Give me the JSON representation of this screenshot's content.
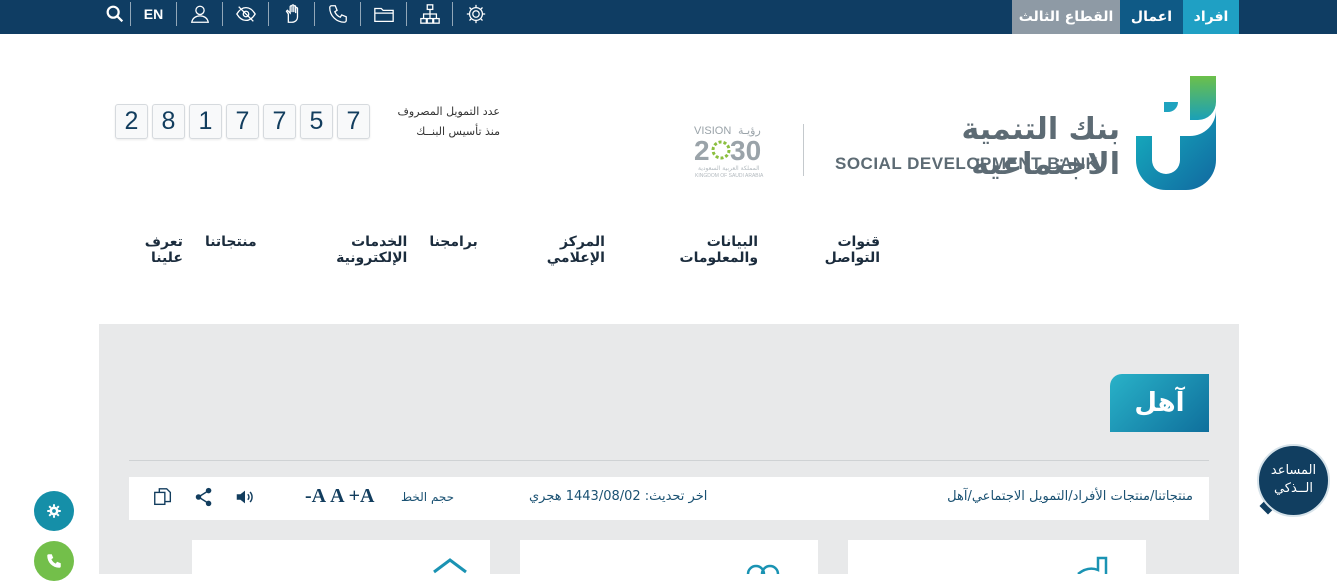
{
  "topbar": {
    "lang_label": "EN",
    "icons": [
      "search-icon",
      "user-icon",
      "eye-slash-icon",
      "sign-language-icon",
      "phone-icon",
      "folder-icon",
      "sitemap-icon",
      "settings-icon"
    ],
    "tabs": {
      "individuals": "افراد",
      "business": "اعمال",
      "third_sector": "القطاع الثالث"
    },
    "colors": {
      "bar": "#0f3d63",
      "individuals": "#1fa0c4",
      "business": "#0f5a86",
      "third_sector": "#8e9aa5"
    }
  },
  "header": {
    "bank_name_ar": "بنك التنمية الاجتماعية",
    "bank_name_en": "SOCIAL DEVELOPMENT BANK",
    "counter": {
      "label_line1": "عدد التمويل المصروف",
      "label_line2": "منذ تأسيس البنــك",
      "digits": [
        "2",
        "8",
        "1",
        "7",
        "7",
        "5",
        "7"
      ]
    }
  },
  "nav": {
    "items": [
      "تعرف علينا",
      "منتجاتنا",
      "الخدمات الإلكترونية",
      "برامجنا",
      "المركز الإعلامي",
      "البيانات والمعلومات",
      "قنوات التواصل"
    ]
  },
  "page": {
    "title": "آهل",
    "breadcrumb": "منتجاتنا/منتجات الأفراد/التمويل الاجتماعي/آهل",
    "updated": "اخر تحديث: 1443/08/02 هجري",
    "font_size_label": "حجم الخط",
    "font_buttons": [
      "A+",
      "A",
      "A-"
    ],
    "tool_icons": [
      "copy-icon",
      "share-icon",
      "speaker-icon"
    ]
  },
  "widgets": {
    "assistant_line1": "المساعد",
    "assistant_line2": "الــذكي",
    "float_icons": [
      "gear-icon",
      "phone-icon"
    ]
  }
}
